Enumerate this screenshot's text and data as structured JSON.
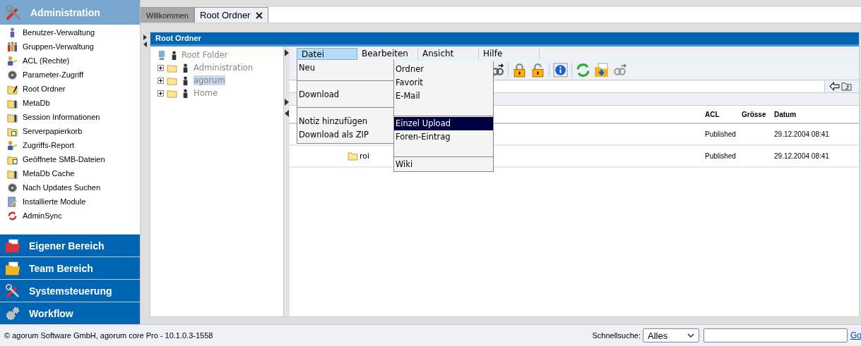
{
  "sidebar": {
    "header": "Administration",
    "items": [
      {
        "label": "Benutzer-Verwaltung"
      },
      {
        "label": "Gruppen-Verwaltung"
      },
      {
        "label": "ACL (Rechte)"
      },
      {
        "label": "Parameter-Zugriff"
      },
      {
        "label": "Root Ordner"
      },
      {
        "label": "MetaDb"
      },
      {
        "label": "Session Informationen"
      },
      {
        "label": "Serverpapierkorb"
      },
      {
        "label": "Zugriffs-Report"
      },
      {
        "label": "Geöffnete SMB-Dateien"
      },
      {
        "label": "MetaDb Cache"
      },
      {
        "label": "Nach Updates Suchen"
      },
      {
        "label": "Installierte Module"
      },
      {
        "label": "AdminSync"
      }
    ],
    "sections": [
      {
        "label": "Eigener Bereich"
      },
      {
        "label": "Team Bereich"
      },
      {
        "label": "Systemsteuerung"
      },
      {
        "label": "Workflow"
      }
    ]
  },
  "tabs": [
    {
      "label": "Willkommen",
      "selected": false
    },
    {
      "label": "Root Ordner",
      "selected": true
    }
  ],
  "panel": {
    "title": "Root Ordner",
    "tree": {
      "label": "Root Folder",
      "children": [
        {
          "label": "Administration",
          "highlighted": false
        },
        {
          "label": "agorum",
          "highlighted": true
        },
        {
          "label": "Home",
          "highlighted": false
        }
      ]
    },
    "menu_bar": [
      {
        "label": "Datei",
        "selected": true
      },
      {
        "label": "Bearbeiten",
        "selected": false
      },
      {
        "label": "Ansicht",
        "selected": false
      },
      {
        "label": "Hilfe",
        "selected": false
      }
    ],
    "file_menu": [
      {
        "kind": "item",
        "label": "Neu"
      },
      {
        "kind": "separator"
      },
      {
        "kind": "item",
        "label": "Download"
      },
      {
        "kind": "separator"
      },
      {
        "kind": "item",
        "label": "Notiz hinzufügen"
      },
      {
        "kind": "item",
        "label": "Download als ZIP"
      }
    ],
    "new_submenu": [
      {
        "kind": "item",
        "label": "Ordner",
        "selected": false
      },
      {
        "kind": "item",
        "label": "Favorit",
        "selected": false
      },
      {
        "kind": "item",
        "label": "E-Mail",
        "selected": false
      },
      {
        "kind": "separator"
      },
      {
        "kind": "item",
        "label": "Einzel Upload",
        "selected": true
      },
      {
        "kind": "item",
        "label": "Foren-Eintrag",
        "selected": false
      },
      {
        "kind": "separator"
      },
      {
        "kind": "item",
        "label": "Wiki",
        "selected": false
      }
    ],
    "table": {
      "columns": [
        "ACL",
        "Grösse",
        "Datum"
      ],
      "rows": [
        {
          "acl": "Published",
          "date": "29.12.2004 08:41"
        },
        {
          "name": "roi",
          "acl": "Published",
          "date": "29.12.2004 08:41"
        }
      ]
    }
  },
  "footer": {
    "copyright": "© agorum Software GmbH, agorum core Pro - 10.1.0.3-1558",
    "search_label": "Schnellsuche:",
    "scope": "Alles",
    "go": "Go"
  }
}
